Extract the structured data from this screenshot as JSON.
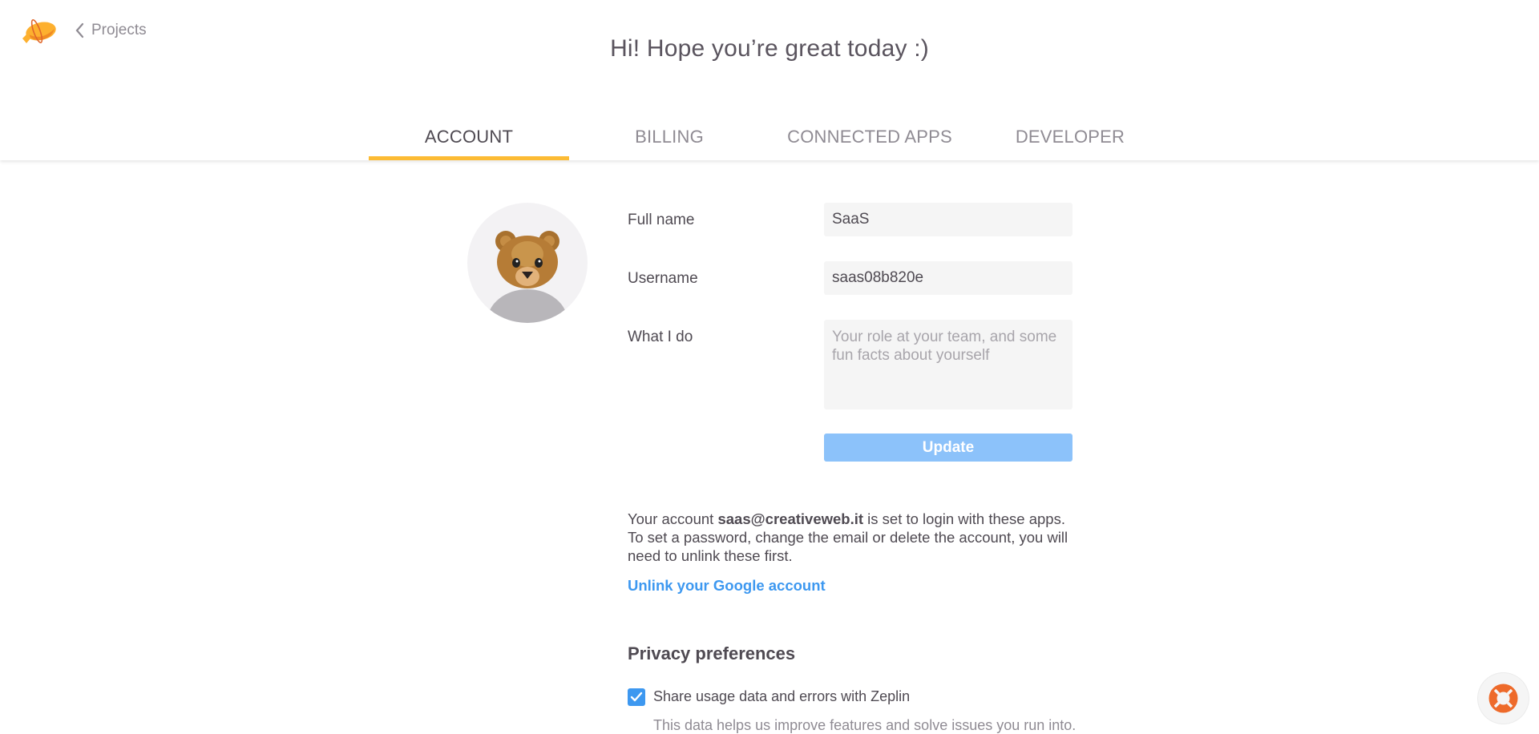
{
  "header": {
    "logo_icon": "zeplin-zeppelin-logo",
    "back_icon": "chevron-left-icon",
    "back_label": "Projects",
    "greeting": "Hi! Hope you’re great today :)"
  },
  "tabs": [
    {
      "label": "ACCOUNT",
      "active": true
    },
    {
      "label": "BILLING",
      "active": false
    },
    {
      "label": "CONNECTED APPS",
      "active": false
    },
    {
      "label": "DEVELOPER",
      "active": false
    }
  ],
  "colors": {
    "accent_tab": "#fcbb34",
    "button_disabled_blue": "#8cc2fa",
    "link_blue": "#3d98f0",
    "help_orange": "#ee6a2a"
  },
  "account": {
    "avatar": "bear-emoji-avatar",
    "fields": {
      "full_name": {
        "label": "Full name",
        "value": "SaaS"
      },
      "username": {
        "label": "Username",
        "value": "saas08b820e"
      },
      "what_i_do": {
        "label": "What I do",
        "value": "",
        "placeholder": "Your role at your team, and some fun facts about yourself"
      }
    },
    "update_label": "Update",
    "info": {
      "prefix": "Your account ",
      "email": "saas@creativeweb.it",
      "suffix": " is set to login with these apps. To set a password, change the email or delete the account, you will need to unlink these first."
    },
    "unlink_label": "Unlink your Google account"
  },
  "privacy": {
    "title": "Privacy preferences",
    "share_usage": {
      "label": "Share usage data and errors with Zeplin",
      "checked": true,
      "description": "This data helps us improve features and solve issues you run into."
    }
  },
  "help": {
    "icon": "lifebuoy-icon"
  }
}
